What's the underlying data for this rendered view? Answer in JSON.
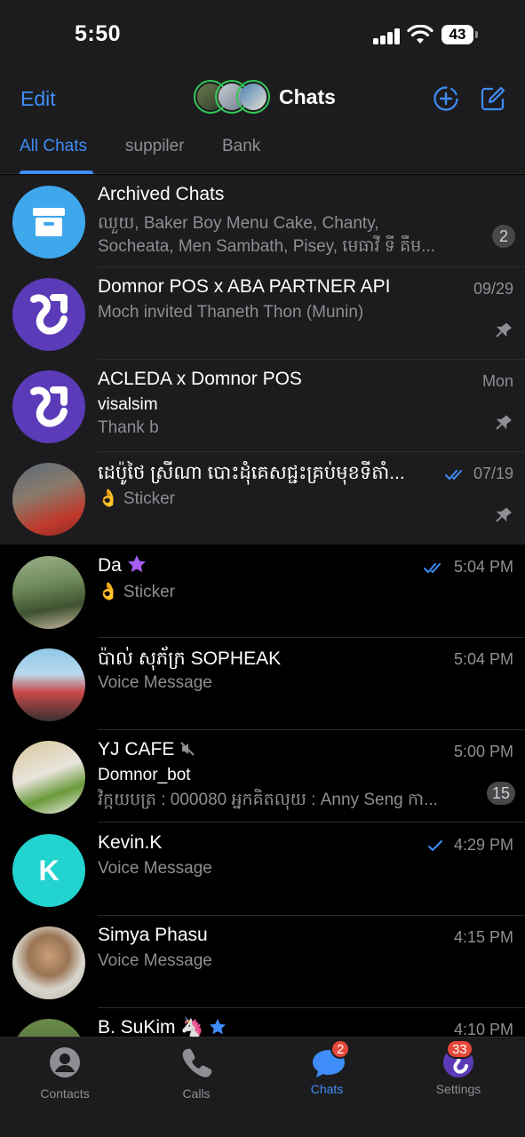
{
  "status": {
    "time": "5:50",
    "battery": "43"
  },
  "nav": {
    "edit": "Edit",
    "title": "Chats"
  },
  "tabs": [
    "All Chats",
    "suppiler",
    "Bank"
  ],
  "chats": [
    {
      "name": "Archived Chats",
      "line1": "ឈួយ, Baker Boy Menu Cake, Chanty,",
      "line2": "Socheata, Men Sambath, Pisey, មេធាវី ទី គឹម...",
      "badge": "2",
      "avatar": "archive-icon"
    },
    {
      "name": "Domnor POS x ABA PARTNER API",
      "date": "09/29",
      "line1": "Moch invited Thaneth Thon (Munin)",
      "pinned": true
    },
    {
      "name": "ACLEDA x Domnor POS",
      "date": "Mon",
      "line1": "visalsim",
      "line2": "Thank b",
      "pinned": true
    },
    {
      "name": "ដេប៉ូថៃ ស្រីណា បោះដុំគេសជ្ជះគ្រប់មុខទីតាំ...",
      "date": "07/19",
      "line1": "👌 Sticker",
      "pinned": true,
      "read": "double"
    },
    {
      "name": "Da",
      "date": "5:04 PM",
      "line1": "👌 Sticker",
      "read": "double"
    },
    {
      "name": "ប៉ាល់ សុភ័ក្រ SOPHEAK",
      "date": "5:04 PM",
      "line1": "Voice Message"
    },
    {
      "name": "YJ CAFE",
      "date": "5:00 PM",
      "line1": "Domnor_bot",
      "line2": "វិក្កយបត្រ : 000080 អ្នកគិតលុយ : Anny Seng កា...",
      "badge": "15",
      "muted": true
    },
    {
      "name": "Kevin.K",
      "date": "4:29 PM",
      "line1": "Voice Message",
      "initial": "K",
      "read": "single"
    },
    {
      "name": "Simya Phasu",
      "date": "4:15 PM",
      "line1": "Voice Message"
    },
    {
      "name": "B. SuKim",
      "date": "4:10 PM",
      "line1": ""
    }
  ],
  "tabbar": {
    "contacts": "Contacts",
    "calls": "Calls",
    "chats": "Chats",
    "chats_badge": "2",
    "settings": "Settings",
    "settings_badge": "33"
  },
  "colors": {
    "accent": "#3e8df8",
    "brand_purple": "#5b3bb8",
    "badge_red": "#e5483a"
  }
}
